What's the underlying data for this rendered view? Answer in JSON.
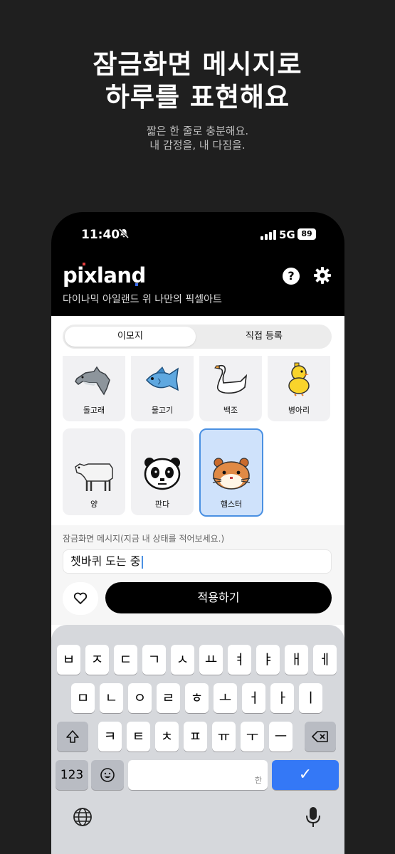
{
  "promo": {
    "title_line1": "잠금화면 메시지로",
    "title_line2": "하루를 표현해요",
    "subtitle_line1": "짧은 한 줄로 충분해요.",
    "subtitle_line2": "내 감정을, 내 다짐을."
  },
  "status_bar": {
    "time": "11:40",
    "network": "5G",
    "battery": "89"
  },
  "header": {
    "logo": "pixland",
    "tagline": "다이나믹 아일랜드 위 나만의 픽셀아트",
    "icons": [
      "help-icon",
      "gear-icon"
    ]
  },
  "tabs": {
    "emoji": "이모지",
    "custom": "직접 등록",
    "active": "emoji"
  },
  "emojis": [
    {
      "label": "돌고래",
      "icon": "dolphin-icon"
    },
    {
      "label": "물고기",
      "icon": "fish-icon"
    },
    {
      "label": "백조",
      "icon": "swan-icon"
    },
    {
      "label": "병아리",
      "icon": "chick-icon"
    },
    {
      "label": "양",
      "icon": "sheep-icon"
    },
    {
      "label": "판다",
      "icon": "panda-icon"
    },
    {
      "label": "햄스터",
      "icon": "hamster-icon",
      "selected": true
    }
  ],
  "message": {
    "label": "잠금화면 메시지(지금 내 상태를 적어보세요.)",
    "value": "쳇바퀴 도는 중"
  },
  "apply_label": "적용하기",
  "keyboard": {
    "row1": [
      "ㅂ",
      "ㅈ",
      "ㄷ",
      "ㄱ",
      "ㅅ",
      "ㅛ",
      "ㅕ",
      "ㅑ",
      "ㅐ",
      "ㅔ"
    ],
    "row2": [
      "ㅁ",
      "ㄴ",
      "ㅇ",
      "ㄹ",
      "ㅎ",
      "ㅗ",
      "ㅓ",
      "ㅏ",
      "ㅣ"
    ],
    "row3": [
      "ㅋ",
      "ㅌ",
      "ㅊ",
      "ㅍ",
      "ㅠ",
      "ㅜ",
      "ㅡ"
    ],
    "numbers_label": "123",
    "space_hint": "한",
    "enter_symbol": "✓"
  },
  "colors": {
    "accent": "#3478f6",
    "selected_card": "#cfe2fb",
    "selected_border": "#4a90e2"
  }
}
